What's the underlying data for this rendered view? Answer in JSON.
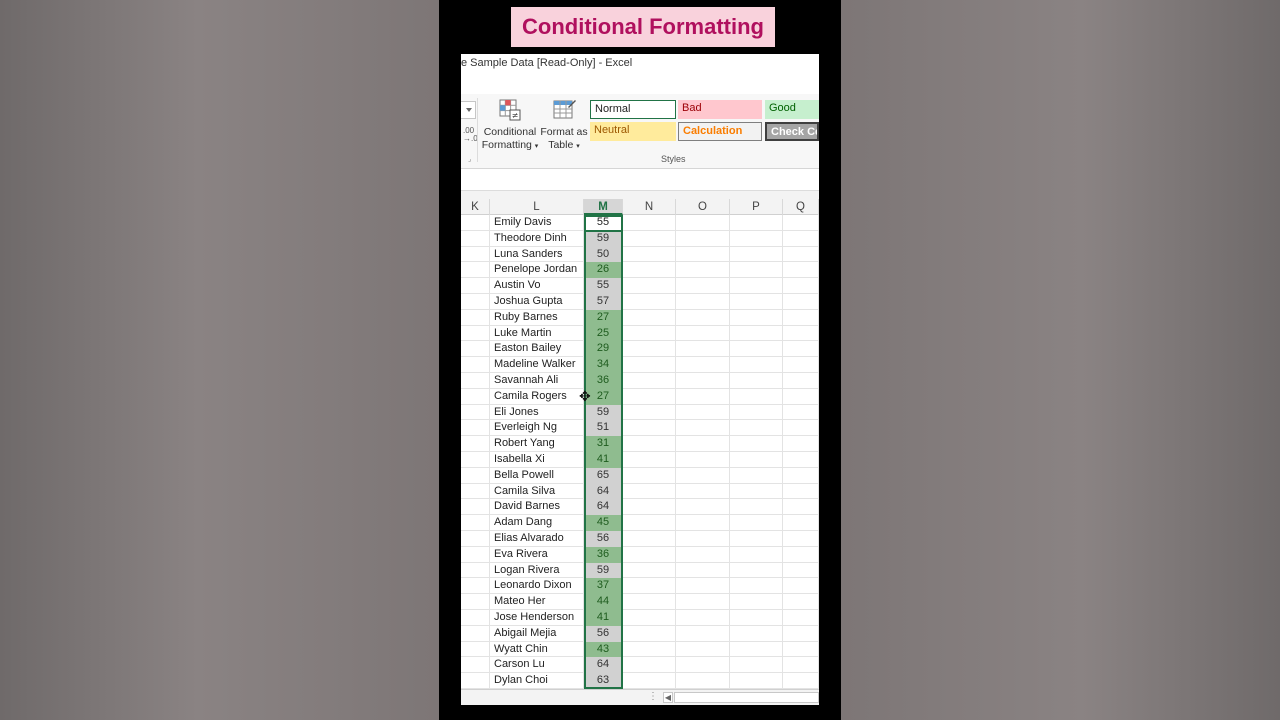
{
  "banner": {
    "title": "Conditional Formatting"
  },
  "window": {
    "title": "e Sample Data  [Read-Only] - Excel"
  },
  "ribbon": {
    "conditional_formatting": {
      "line1": "Conditional",
      "line2": "Formatting",
      "icon": "conditional-formatting-icon"
    },
    "format_as_table": {
      "line1": "Format as",
      "line2": "Table",
      "icon": "format-as-table-icon"
    },
    "styles": {
      "normal": "Normal",
      "bad": "Bad",
      "good": "Good",
      "neutral": "Neutral",
      "calculation": "Calculation",
      "check_cell": "Check Cell",
      "group_label": "Styles"
    },
    "colors": {
      "bad_bg": "#ffc7ce",
      "bad_fg": "#9c0006",
      "good_bg": "#c6efce",
      "good_fg": "#006100",
      "neutral_bg": "#ffeb9c",
      "neutral_fg": "#9c5700",
      "calculation_fg": "#fa7d00",
      "check_bg": "#a5a5a5"
    }
  },
  "columns": [
    "K",
    "L",
    "M",
    "N",
    "O",
    "P",
    "Q"
  ],
  "active_column": "M",
  "rows": [
    {
      "name": "Emily Davis",
      "value": "55",
      "fmt": "first"
    },
    {
      "name": "Theodore Dinh",
      "value": "59",
      "fmt": "grey"
    },
    {
      "name": "Luna Sanders",
      "value": "50",
      "fmt": "grey"
    },
    {
      "name": "Penelope Jordan",
      "value": "26",
      "fmt": "green"
    },
    {
      "name": "Austin Vo",
      "value": "55",
      "fmt": "grey"
    },
    {
      "name": "Joshua Gupta",
      "value": "57",
      "fmt": "grey"
    },
    {
      "name": "Ruby Barnes",
      "value": "27",
      "fmt": "green"
    },
    {
      "name": "Luke Martin",
      "value": "25",
      "fmt": "green"
    },
    {
      "name": "Easton Bailey",
      "value": "29",
      "fmt": "green"
    },
    {
      "name": "Madeline Walker",
      "value": "34",
      "fmt": "green"
    },
    {
      "name": "Savannah Ali",
      "value": "36",
      "fmt": "green"
    },
    {
      "name": "Camila Rogers",
      "value": "27",
      "fmt": "green"
    },
    {
      "name": "Eli Jones",
      "value": "59",
      "fmt": "grey"
    },
    {
      "name": "Everleigh Ng",
      "value": "51",
      "fmt": "grey"
    },
    {
      "name": "Robert Yang",
      "value": "31",
      "fmt": "green"
    },
    {
      "name": "Isabella Xi",
      "value": "41",
      "fmt": "green"
    },
    {
      "name": "Bella Powell",
      "value": "65",
      "fmt": "grey"
    },
    {
      "name": "Camila Silva",
      "value": "64",
      "fmt": "grey"
    },
    {
      "name": "David Barnes",
      "value": "64",
      "fmt": "grey"
    },
    {
      "name": "Adam Dang",
      "value": "45",
      "fmt": "green"
    },
    {
      "name": "Elias Alvarado",
      "value": "56",
      "fmt": "grey"
    },
    {
      "name": "Eva Rivera",
      "value": "36",
      "fmt": "green"
    },
    {
      "name": "Logan Rivera",
      "value": "59",
      "fmt": "grey"
    },
    {
      "name": "Leonardo Dixon",
      "value": "37",
      "fmt": "green"
    },
    {
      "name": "Mateo Her",
      "value": "44",
      "fmt": "green"
    },
    {
      "name": "Jose Henderson",
      "value": "41",
      "fmt": "green"
    },
    {
      "name": "Abigail Mejia",
      "value": "56",
      "fmt": "grey"
    },
    {
      "name": "Wyatt Chin",
      "value": "43",
      "fmt": "green"
    },
    {
      "name": "Carson Lu",
      "value": "64",
      "fmt": "grey"
    },
    {
      "name": "Dylan Choi",
      "value": "63",
      "fmt": "grey"
    }
  ]
}
